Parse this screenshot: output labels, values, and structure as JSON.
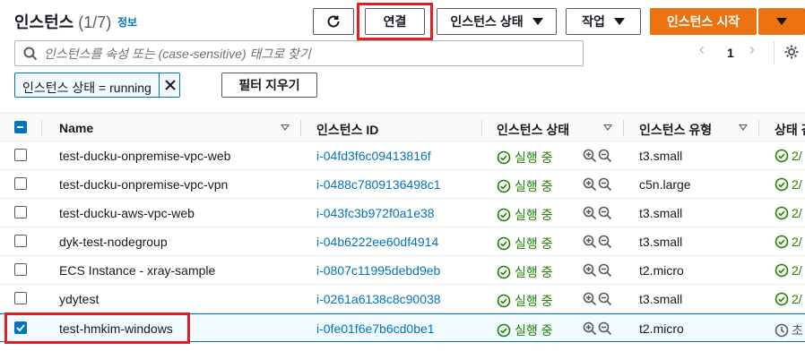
{
  "header": {
    "title": "인스턴스",
    "count": "(1/7)",
    "info_link": "정보",
    "buttons": {
      "connect": "연결",
      "instance_state": "인스턴스 상태",
      "actions": "작업",
      "launch": "인스턴스 시작"
    }
  },
  "search": {
    "placeholder": "인스턴스를 속성 또는 (case-sensitive) 태그로 찾기"
  },
  "pagination": {
    "prev": "‹",
    "page": "1",
    "next": "›"
  },
  "filter": {
    "token": "인스턴스 상태 = running",
    "clear_label": "필터 지우기"
  },
  "table": {
    "columns": {
      "name": "Name",
      "instance_id": "인스턴스 ID",
      "instance_state": "인스턴스 상태",
      "instance_type": "인스턴스 유형",
      "status_check": "상태 검"
    },
    "rows": [
      {
        "name": "test-ducku-onpremise-vpc-web",
        "id": "i-04fd3f6c09413816f",
        "state": "실행 중",
        "type": "t3.small",
        "status": "2/",
        "selected": false
      },
      {
        "name": "test-ducku-onpremise-vpc-vpn",
        "id": "i-0488c7809136498c1",
        "state": "실행 중",
        "type": "c5n.large",
        "status": "2/",
        "selected": false
      },
      {
        "name": "test-ducku-aws-vpc-web",
        "id": "i-043fc3b972f0a1e38",
        "state": "실행 중",
        "type": "t3.small",
        "status": "2/",
        "selected": false
      },
      {
        "name": "dyk-test-nodegroup",
        "id": "i-04b6222ee60df4914",
        "state": "실행 중",
        "type": "t3.small",
        "status": "2/",
        "selected": false
      },
      {
        "name": "ECS Instance - xray-sample",
        "id": "i-0807c11995debd9eb",
        "state": "실행 중",
        "type": "t2.micro",
        "status": "2/",
        "selected": false
      },
      {
        "name": "ydytest",
        "id": "i-0261a6138c8c90038",
        "state": "실행 중",
        "type": "t3.small",
        "status": "2/",
        "selected": false
      },
      {
        "name": "test-hmkim-windows",
        "id": "i-0fe01f6e7b6cd0be1",
        "state": "실행 중",
        "type": "t2.micro",
        "status": "초",
        "selected": true
      }
    ]
  },
  "colors": {
    "accent": "#0073bb",
    "primary_button": "#ec7211",
    "running": "#1d8102",
    "highlight": "#e02020"
  }
}
